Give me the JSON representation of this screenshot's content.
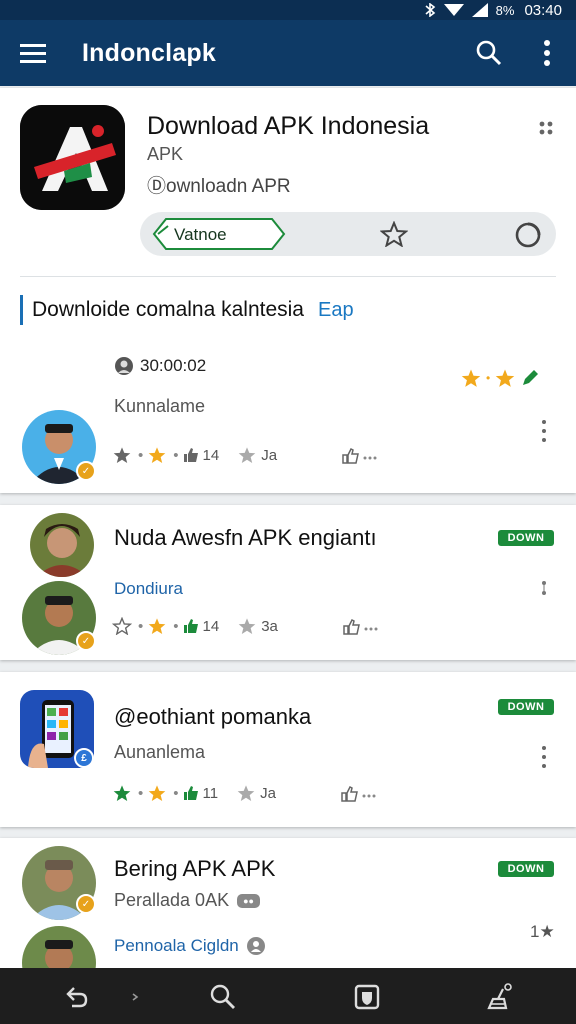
{
  "status_bar": {
    "time": "03:40",
    "battery": "8%",
    "icons": [
      "bluetooth-icon",
      "wifi-icon",
      "signal-icon"
    ]
  },
  "app_bar": {
    "title": "Indonclapk",
    "icons": [
      "menu-icon",
      "search-icon",
      "more-vert-icon"
    ]
  },
  "featured": {
    "title": "Download APK Indonesia",
    "subtitle": "APK",
    "download_label": "Ⓓownloadn APR",
    "tag_label": "Vatnoe",
    "icons": [
      "app-logo-icon",
      "drag-handle-icon",
      "star-outline-icon",
      "circle-icon"
    ]
  },
  "section": {
    "title": "Downloide comalna kalntesia",
    "link": "Eap"
  },
  "items": [
    {
      "timer": "30:00:02",
      "name": "Kunnalame",
      "stat_likes": "14",
      "stat_rating": "Ja",
      "top_icons": [
        "star-icon",
        "star-icon",
        "pen-icon"
      ]
    },
    {
      "title": "Nuda Awesfn APK engiantı",
      "link": "Dondiura",
      "badge": "DOWN",
      "stat_likes": "14",
      "stat_rating": "3a",
      "side_icon": "hourglass-icon"
    },
    {
      "title": "@eothiant pomanka",
      "name": "Aunanlema",
      "badge": "DOWN",
      "stat_likes": "11",
      "stat_rating": "Ja"
    },
    {
      "title": "Bering APK APK",
      "subtitle": "Perallada 0AK",
      "subtitle_tag": "●●",
      "link": "Pennoala Cigldn",
      "badge": "DOWN",
      "side_text": "1★"
    }
  ],
  "bottom_nav": {
    "icons": [
      "back-icon",
      "chevron-right-icon",
      "search-icon",
      "shield-icon",
      "broom-icon"
    ]
  },
  "colors": {
    "app_bar": "#0e3a66",
    "accent_green": "#1c8b3b",
    "star_gold": "#f2a91c",
    "link_blue": "#1a78c2"
  }
}
